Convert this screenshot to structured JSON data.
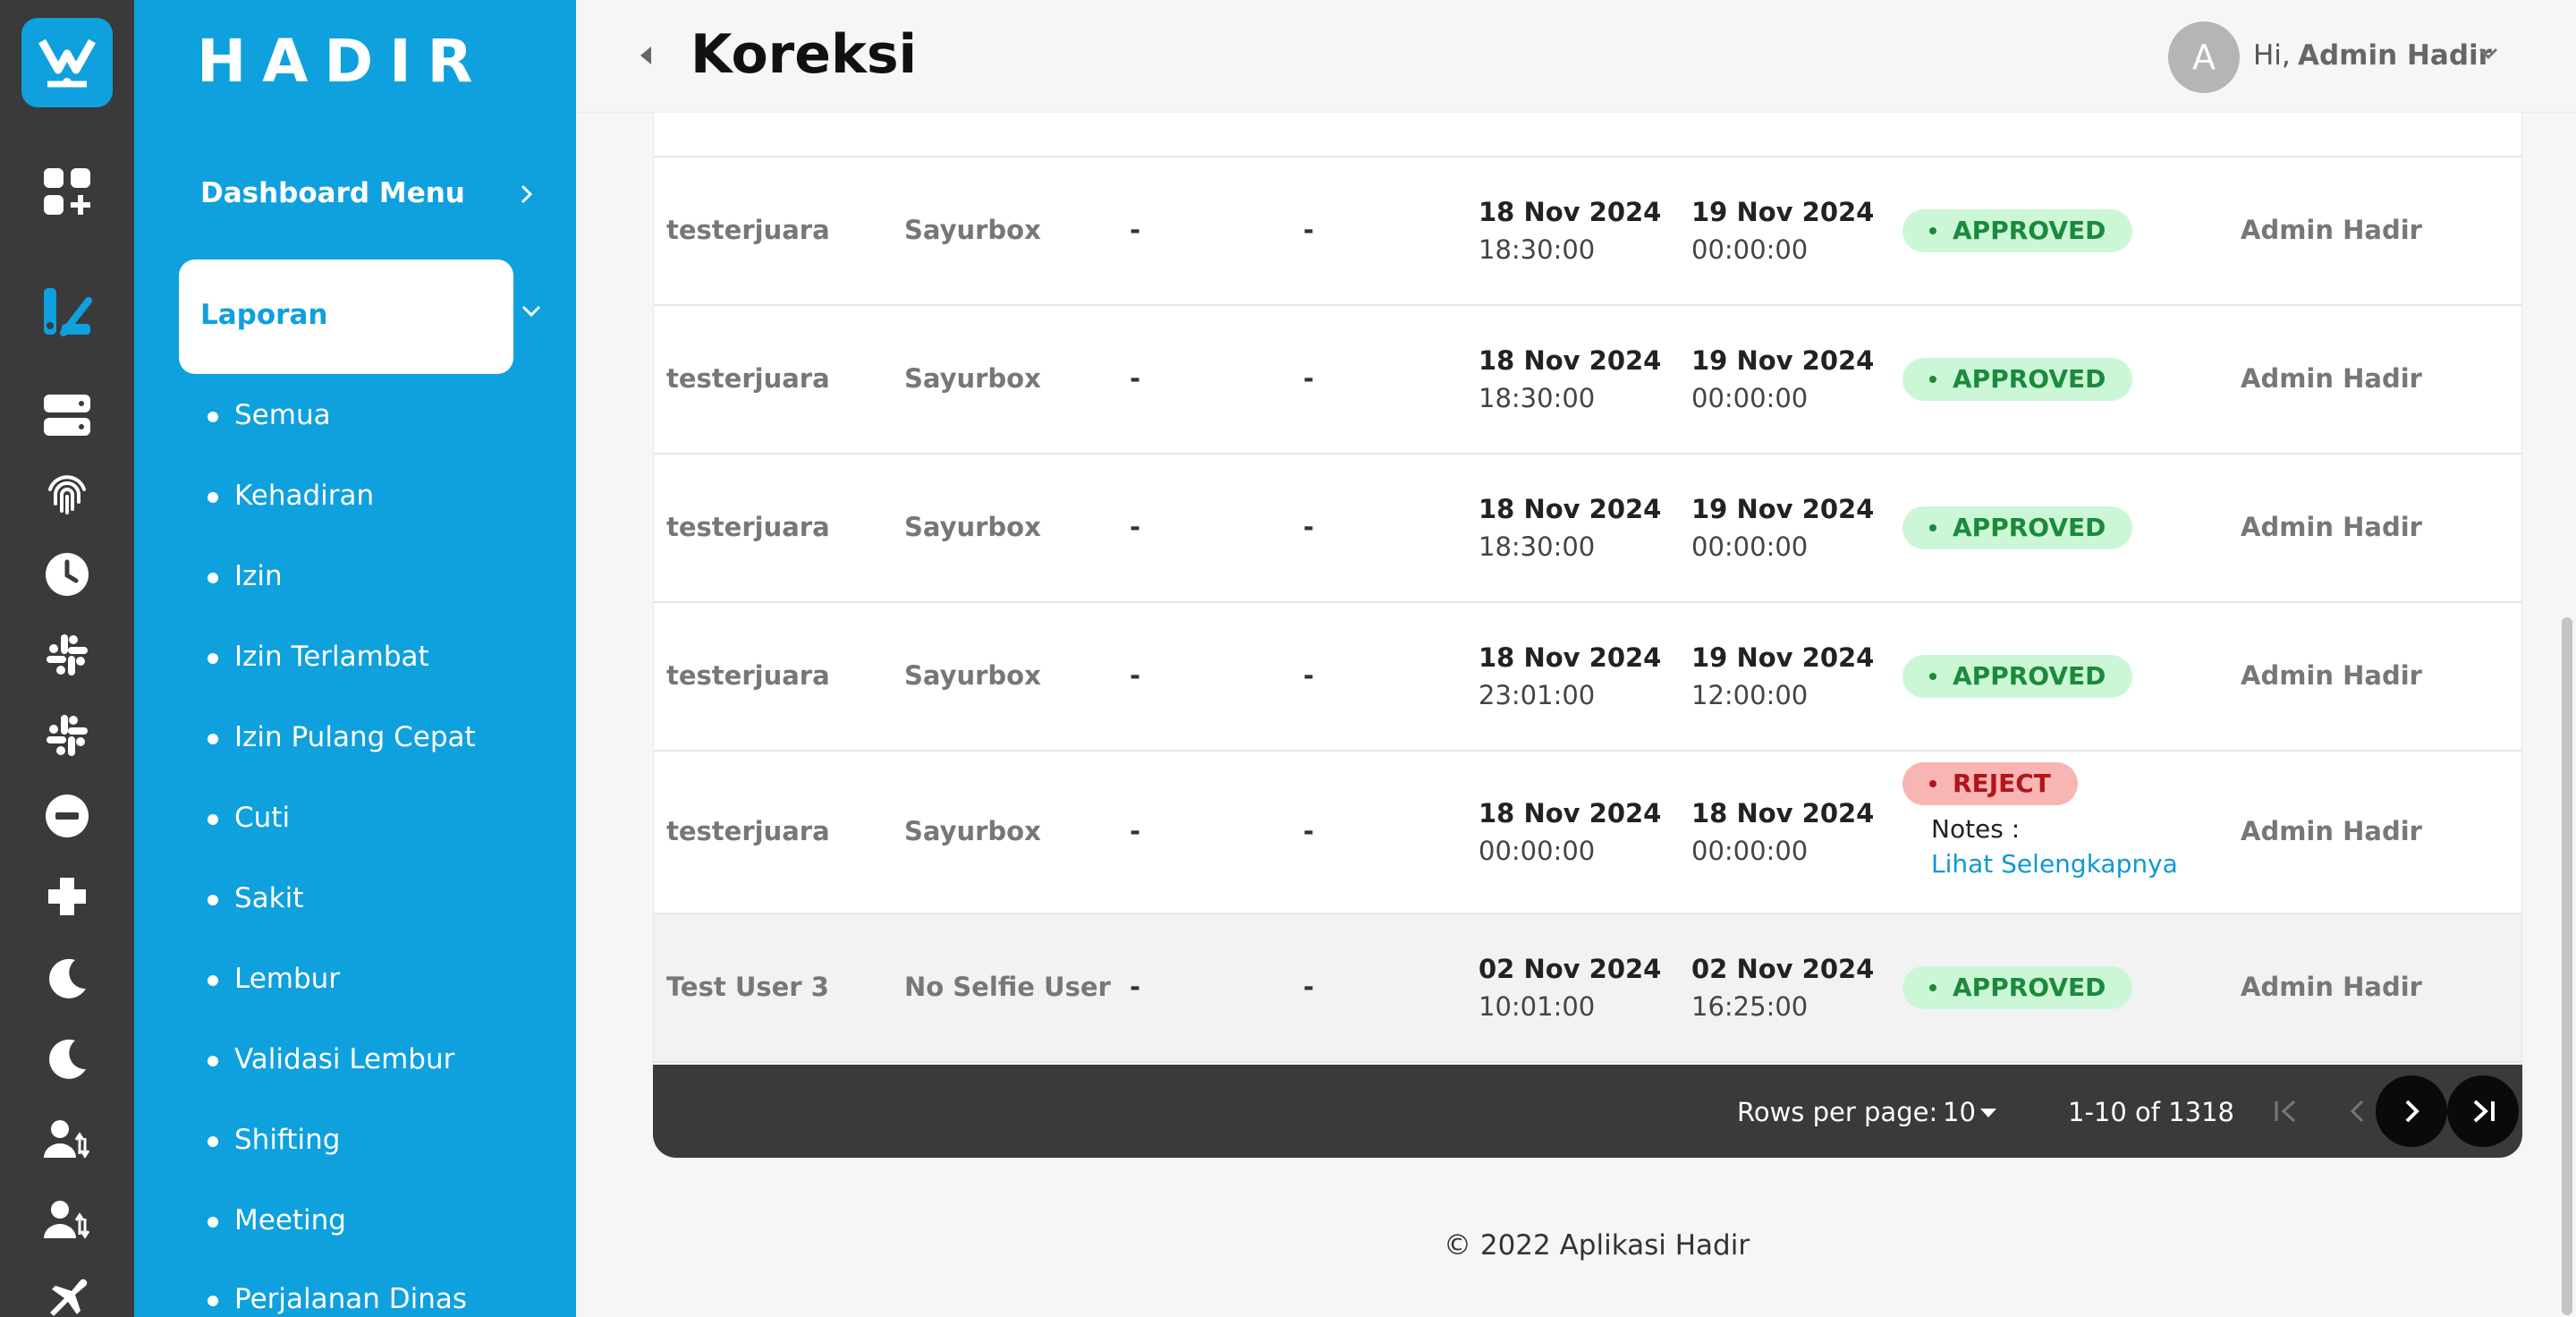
{
  "brand": {
    "name": "HADIR",
    "color": "#0fa0de"
  },
  "rail_icons": [
    "logo-icon",
    "dashboard-add-icon",
    "report-icon",
    "server-icon",
    "fingerprint-icon",
    "clock-icon",
    "slack-icon",
    "slack-alt-icon",
    "minus-circle-icon",
    "plus-cross-icon",
    "moon-icon",
    "moon-alt-icon",
    "user-transfer-icon",
    "user-transfer-alt-icon",
    "airplane-icon"
  ],
  "nav": {
    "dashboard_label": "Dashboard Menu",
    "active_label": "Laporan",
    "sub_items": [
      "Semua",
      "Kehadiran",
      "Izin",
      "Izin Terlambat",
      "Izin Pulang Cepat",
      "Cuti",
      "Sakit",
      "Lembur",
      "Validasi Lembur",
      "Shifting",
      "Meeting",
      "Perjalanan Dinas"
    ]
  },
  "header": {
    "title": "Koreksi",
    "avatar_letter": "A",
    "greeting": "Hi,",
    "user_name": "Admin Hadir"
  },
  "rows": [
    {
      "name": "testerjuara",
      "company": "Sayurbox",
      "col3": "-",
      "col4": "-",
      "start_date": "18 Nov 2024",
      "start_time": "18:30:00",
      "end_date": "19 Nov 2024",
      "end_time": "00:00:00",
      "status": "APPROVED",
      "approver": "Admin Hadir"
    },
    {
      "name": "testerjuara",
      "company": "Sayurbox",
      "col3": "-",
      "col4": "-",
      "start_date": "18 Nov 2024",
      "start_time": "18:30:00",
      "end_date": "19 Nov 2024",
      "end_time": "00:00:00",
      "status": "APPROVED",
      "approver": "Admin Hadir"
    },
    {
      "name": "testerjuara",
      "company": "Sayurbox",
      "col3": "-",
      "col4": "-",
      "start_date": "18 Nov 2024",
      "start_time": "18:30:00",
      "end_date": "19 Nov 2024",
      "end_time": "00:00:00",
      "status": "APPROVED",
      "approver": "Admin Hadir"
    },
    {
      "name": "testerjuara",
      "company": "Sayurbox",
      "col3": "-",
      "col4": "-",
      "start_date": "18 Nov 2024",
      "start_time": "23:01:00",
      "end_date": "19 Nov 2024",
      "end_time": "12:00:00",
      "status": "APPROVED",
      "approver": "Admin Hadir"
    },
    {
      "name": "testerjuara",
      "company": "Sayurbox",
      "col3": "-",
      "col4": "-",
      "start_date": "18 Nov 2024",
      "start_time": "00:00:00",
      "end_date": "18 Nov 2024",
      "end_time": "00:00:00",
      "status": "REJECT",
      "notes_label": "Notes :",
      "notes_link": "Lihat Selengkapnya",
      "approver": "Admin Hadir"
    },
    {
      "name": "Test User 3",
      "company": "No Selfie User",
      "col3": "-",
      "col4": "-",
      "start_date": "02 Nov 2024",
      "start_time": "10:01:00",
      "end_date": "02 Nov 2024",
      "end_time": "16:25:00",
      "status": "APPROVED",
      "approver": "Admin Hadir"
    }
  ],
  "pagination": {
    "rows_per_page_label": "Rows per page:",
    "rows_per_page": "10",
    "range": "1-10 of 1318"
  },
  "footer": {
    "copyright": "© 2022 Aplikasi Hadir"
  }
}
